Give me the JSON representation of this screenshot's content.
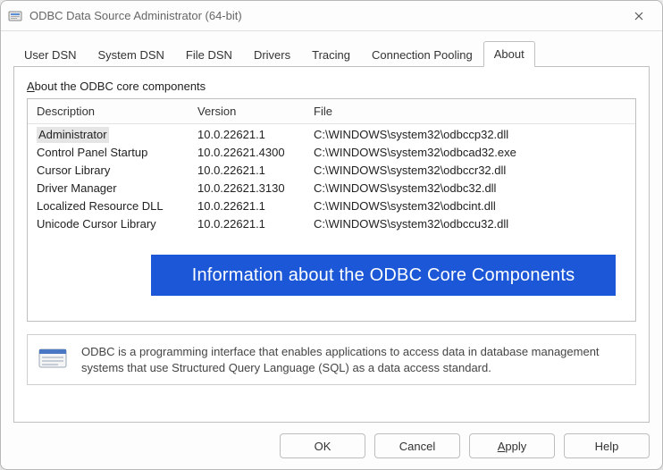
{
  "window": {
    "title": "ODBC Data Source Administrator (64-bit)"
  },
  "tabs": [
    {
      "label": "User DSN"
    },
    {
      "label": "System DSN"
    },
    {
      "label": "File DSN"
    },
    {
      "label": "Drivers"
    },
    {
      "label": "Tracing"
    },
    {
      "label": "Connection Pooling"
    },
    {
      "label": "About"
    }
  ],
  "active_tab_index": 6,
  "about": {
    "section_accel": "A",
    "section_rest": "bout the ODBC core components",
    "columns": {
      "desc": "Description",
      "version": "Version",
      "file": "File"
    },
    "rows": [
      {
        "desc": "Administrator",
        "version": "10.0.22621.1",
        "file": "C:\\WINDOWS\\system32\\odbccp32.dll",
        "selected": true
      },
      {
        "desc": "Control Panel Startup",
        "version": "10.0.22621.4300",
        "file": "C:\\WINDOWS\\system32\\odbcad32.exe"
      },
      {
        "desc": "Cursor Library",
        "version": "10.0.22621.1",
        "file": "C:\\WINDOWS\\system32\\odbccr32.dll"
      },
      {
        "desc": "Driver Manager",
        "version": "10.0.22621.3130",
        "file": "C:\\WINDOWS\\system32\\odbc32.dll"
      },
      {
        "desc": "Localized Resource DLL",
        "version": "10.0.22621.1",
        "file": "C:\\WINDOWS\\system32\\odbcint.dll"
      },
      {
        "desc": "Unicode Cursor Library",
        "version": "10.0.22621.1",
        "file": "C:\\WINDOWS\\system32\\odbccu32.dll"
      }
    ],
    "overlay_text": "Information about the ODBC Core Components",
    "info_text": "ODBC is a programming interface that enables applications to access data in database management systems that use Structured Query Language (SQL) as a data access standard."
  },
  "buttons": {
    "ok": "OK",
    "cancel": "Cancel",
    "apply_accel": "A",
    "apply_rest": "pply",
    "help": "Help"
  }
}
